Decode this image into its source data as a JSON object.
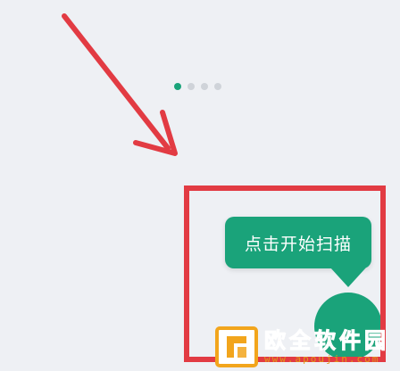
{
  "tooltip": {
    "text": "点击开始扫描"
  },
  "pager": {
    "count": 4,
    "active_index": 0
  },
  "watermark": {
    "title": "欧全软件园",
    "url": "www.apoujin.com"
  },
  "colors": {
    "background": "#eef0f4",
    "accent_green": "#1aa37a",
    "annotation_red": "#e23b43",
    "dot_inactive": "#cfd3d9",
    "watermark_orange": "#f2a51c"
  },
  "icons": {
    "scan_button": "scan-fab-icon",
    "watermark_logo": "apoujin-logo-icon"
  }
}
